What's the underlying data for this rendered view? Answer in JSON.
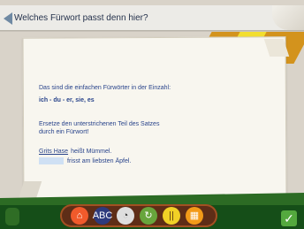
{
  "top_bar": {
    "question": "Welches Fürwort passt denn hier?"
  },
  "content": {
    "line_1": "Das sind die einfachen Fürwörter in der Einzahl:",
    "line_2": "ich - du - er, sie, es",
    "line_3": "Ersetze den unterstrichenen Teil des Satzes",
    "line_4": "durch ein Fürwort!",
    "sentence_1_underlined": "Grits Hase",
    "sentence_1_rest": "heißt Mümmel.",
    "sentence_2_rest": "frisst am liebsten Äpfel."
  },
  "toolbar": {
    "buttons": [
      {
        "name": "home-icon",
        "glyph": "⌂"
      },
      {
        "name": "alphabet-icon",
        "glyph": "ABC"
      },
      {
        "name": "sound-icon",
        "glyph": "◔"
      },
      {
        "name": "repeat-icon",
        "glyph": "↻"
      },
      {
        "name": "bars-icon",
        "glyph": "||"
      },
      {
        "name": "chart-icon",
        "glyph": "▦"
      }
    ]
  },
  "bottom_right": {
    "check_glyph": "✓"
  },
  "colors": {
    "accent_blue": "#29448b",
    "paper": "#f8f6ef",
    "green_dark": "#154e18",
    "orange": "#d3931d",
    "yellow": "#f2de2f"
  }
}
